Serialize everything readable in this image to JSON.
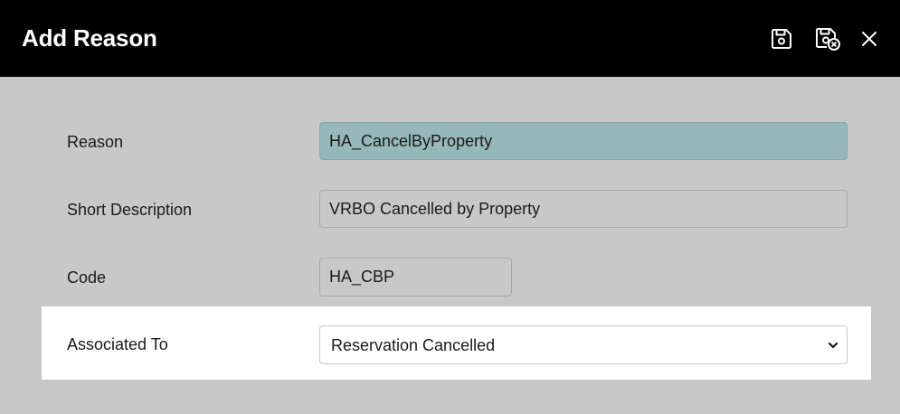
{
  "dialog": {
    "title": "Add Reason",
    "toolbar": {
      "save_icon": "save-icon",
      "save_close_icon": "save-and-close-icon",
      "close_icon": "close-icon"
    }
  },
  "form": {
    "reason": {
      "label": "Reason",
      "value": "HA_CancelByProperty"
    },
    "short_description": {
      "label": "Short Description",
      "value": "VRBO Cancelled by Property"
    },
    "code": {
      "label": "Code",
      "value": "HA_CBP"
    },
    "associated_to": {
      "label": "Associated To",
      "selected": "Reservation Cancelled"
    }
  },
  "colors": {
    "header_bg": "#000000",
    "content_bg": "#c8c8c8",
    "highlight_field": "#96b8bb",
    "panel_bg": "#ffffff"
  }
}
